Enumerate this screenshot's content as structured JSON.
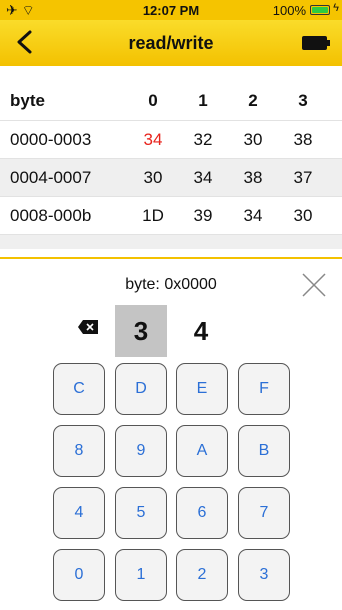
{
  "status_bar": {
    "time": "12:07 PM",
    "battery_percent": "100%",
    "airplane_icon": "airplane-icon",
    "wifi_icon": "wifi-icon"
  },
  "nav": {
    "title": "read/write",
    "back_icon": "chevron-left-icon",
    "device_battery_icon": "battery-full-icon"
  },
  "table": {
    "header": {
      "label": "byte",
      "columns": [
        "0",
        "1",
        "2",
        "3"
      ]
    },
    "rows": [
      {
        "address": "0000-0003",
        "values": [
          "34",
          "32",
          "30",
          "38"
        ]
      },
      {
        "address": "0004-0007",
        "values": [
          "30",
          "34",
          "38",
          "37"
        ]
      },
      {
        "address": "0008-000b",
        "values": [
          "1D",
          "39",
          "34",
          "30"
        ]
      }
    ]
  },
  "keypad": {
    "title": "byte: 0x0000",
    "digits": [
      "3",
      "4"
    ],
    "keys": [
      [
        "C",
        "D",
        "E",
        "F"
      ],
      [
        "8",
        "9",
        "A",
        "B"
      ],
      [
        "4",
        "5",
        "6",
        "7"
      ],
      [
        "0",
        "1",
        "2",
        "3"
      ]
    ]
  },
  "colors": {
    "accent_yellow": "#f3c100",
    "highlight_red": "#e8231c",
    "key_text_blue": "#2b6fd6"
  }
}
